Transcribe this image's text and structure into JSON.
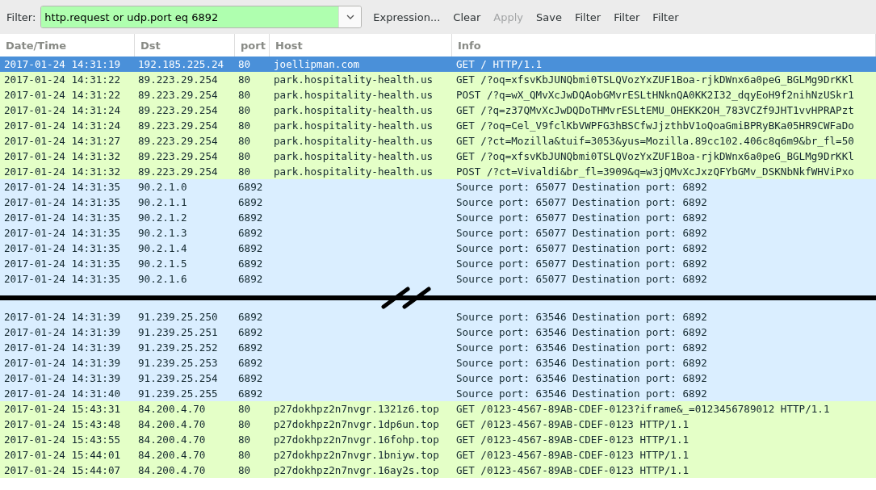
{
  "toolbar": {
    "label": "Filter:",
    "filter": {
      "value": "http.request or udp.port eq 6892",
      "valid": true
    },
    "buttons": [
      {
        "label": "Expression...",
        "disabled": false
      },
      {
        "label": "Clear",
        "disabled": false
      },
      {
        "label": "Apply",
        "disabled": true
      },
      {
        "label": "Save",
        "disabled": false
      },
      {
        "label": "Filter",
        "disabled": false
      },
      {
        "label": "Filter",
        "disabled": false
      },
      {
        "label": "Filter",
        "disabled": false
      }
    ]
  },
  "table": {
    "columns": [
      "Date/Time",
      "Dst",
      "port",
      "Host",
      "Info"
    ],
    "rows": [
      {
        "kind": "http",
        "selected": true,
        "cells": [
          "2017-01-24 14:31:19",
          "192.185.225.24",
          "80",
          "joellipman.com",
          "GET / HTTP/1.1"
        ]
      },
      {
        "kind": "http",
        "selected": false,
        "cells": [
          "2017-01-24 14:31:22",
          "89.223.29.254",
          "80",
          "park.hospitality-health.us",
          "GET /?oq=xfsvKbJUNQbmi0TSLQVozYxZUF1Boa-rjkDWnx6a0peG_BGLMg9DrKKl"
        ]
      },
      {
        "kind": "http",
        "selected": false,
        "cells": [
          "2017-01-24 14:31:22",
          "89.223.29.254",
          "80",
          "park.hospitality-health.us",
          "POST /?q=wX_QMvXcJwDQAobGMvrESLtHNknQA0KK2I32_dqyEoH9f2nihNzUSkr1"
        ]
      },
      {
        "kind": "http",
        "selected": false,
        "cells": [
          "2017-01-24 14:31:24",
          "89.223.29.254",
          "80",
          "park.hospitality-health.us",
          "GET /?q=z37QMvXcJwDQDoTHMvrESLtEMU_OHEKK2OH_783VCZf9JHT1vvHPRAPzt"
        ]
      },
      {
        "kind": "http",
        "selected": false,
        "cells": [
          "2017-01-24 14:31:24",
          "89.223.29.254",
          "80",
          "park.hospitality-health.us",
          "GET /?oq=Cel_V9fclKbVWPFG3hBSCfwJjzthbV1oQoaGmiBPRyBKa05HR9CWFaDo"
        ]
      },
      {
        "kind": "http",
        "selected": false,
        "cells": [
          "2017-01-24 14:31:27",
          "89.223.29.254",
          "80",
          "park.hospitality-health.us",
          "GET /?ct=Mozilla&tuif=3053&yus=Mozilla.89cc102.406c8q6m9&br_fl=50"
        ]
      },
      {
        "kind": "http",
        "selected": false,
        "cells": [
          "2017-01-24 14:31:32",
          "89.223.29.254",
          "80",
          "park.hospitality-health.us",
          "GET /?oq=xfsvKbJUNQbmi0TSLQVozYxZUF1Boa-rjkDWnx6a0peG_BGLMg9DrKKl"
        ]
      },
      {
        "kind": "http",
        "selected": false,
        "cells": [
          "2017-01-24 14:31:32",
          "89.223.29.254",
          "80",
          "park.hospitality-health.us",
          "POST /?ct=Vivaldi&br_fl=3909&q=w3jQMvXcJxzQFYbGMv_DSKNbNkfWHViPxo"
        ]
      },
      {
        "kind": "udp",
        "selected": false,
        "cells": [
          "2017-01-24 14:31:35",
          "90.2.1.0",
          "6892",
          "",
          "Source port: 65077  Destination port: 6892"
        ]
      },
      {
        "kind": "udp",
        "selected": false,
        "cells": [
          "2017-01-24 14:31:35",
          "90.2.1.1",
          "6892",
          "",
          "Source port: 65077  Destination port: 6892"
        ]
      },
      {
        "kind": "udp",
        "selected": false,
        "cells": [
          "2017-01-24 14:31:35",
          "90.2.1.2",
          "6892",
          "",
          "Source port: 65077  Destination port: 6892"
        ]
      },
      {
        "kind": "udp",
        "selected": false,
        "cells": [
          "2017-01-24 14:31:35",
          "90.2.1.3",
          "6892",
          "",
          "Source port: 65077  Destination port: 6892"
        ]
      },
      {
        "kind": "udp",
        "selected": false,
        "cells": [
          "2017-01-24 14:31:35",
          "90.2.1.4",
          "6892",
          "",
          "Source port: 65077  Destination port: 6892"
        ]
      },
      {
        "kind": "udp",
        "selected": false,
        "cells": [
          "2017-01-24 14:31:35",
          "90.2.1.5",
          "6892",
          "",
          "Source port: 65077  Destination port: 6892"
        ]
      },
      {
        "kind": "udp",
        "selected": false,
        "cells": [
          "2017-01-24 14:31:35",
          "90.2.1.6",
          "6892",
          "",
          "Source port: 65077  Destination port: 6892"
        ]
      },
      {
        "kind": "break"
      },
      {
        "kind": "udp",
        "selected": false,
        "cells": [
          "2017-01-24 14:31:39",
          "91.239.25.250",
          "6892",
          "",
          "Source port: 63546  Destination port: 6892"
        ]
      },
      {
        "kind": "udp",
        "selected": false,
        "cells": [
          "2017-01-24 14:31:39",
          "91.239.25.251",
          "6892",
          "",
          "Source port: 63546  Destination port: 6892"
        ]
      },
      {
        "kind": "udp",
        "selected": false,
        "cells": [
          "2017-01-24 14:31:39",
          "91.239.25.252",
          "6892",
          "",
          "Source port: 63546  Destination port: 6892"
        ]
      },
      {
        "kind": "udp",
        "selected": false,
        "cells": [
          "2017-01-24 14:31:39",
          "91.239.25.253",
          "6892",
          "",
          "Source port: 63546  Destination port: 6892"
        ]
      },
      {
        "kind": "udp",
        "selected": false,
        "cells": [
          "2017-01-24 14:31:39",
          "91.239.25.254",
          "6892",
          "",
          "Source port: 63546  Destination port: 6892"
        ]
      },
      {
        "kind": "udp",
        "selected": false,
        "cells": [
          "2017-01-24 14:31:40",
          "91.239.25.255",
          "6892",
          "",
          "Source port: 63546  Destination port: 6892"
        ]
      },
      {
        "kind": "http",
        "selected": false,
        "cells": [
          "2017-01-24 15:43:31",
          "84.200.4.70",
          "80",
          "p27dokhpz2n7nvgr.1321z6.top",
          "GET /0123-4567-89AB-CDEF-0123?iframe&_=0123456789012 HTTP/1.1"
        ]
      },
      {
        "kind": "http",
        "selected": false,
        "cells": [
          "2017-01-24 15:43:48",
          "84.200.4.70",
          "80",
          "p27dokhpz2n7nvgr.1dp6un.top",
          "GET /0123-4567-89AB-CDEF-0123 HTTP/1.1"
        ]
      },
      {
        "kind": "http",
        "selected": false,
        "cells": [
          "2017-01-24 15:43:55",
          "84.200.4.70",
          "80",
          "p27dokhpz2n7nvgr.16fohp.top",
          "GET /0123-4567-89AB-CDEF-0123 HTTP/1.1"
        ]
      },
      {
        "kind": "http",
        "selected": false,
        "cells": [
          "2017-01-24 15:44:01",
          "84.200.4.70",
          "80",
          "p27dokhpz2n7nvgr.1bniyw.top",
          "GET /0123-4567-89AB-CDEF-0123 HTTP/1.1"
        ]
      },
      {
        "kind": "http",
        "selected": false,
        "cells": [
          "2017-01-24 15:44:07",
          "84.200.4.70",
          "80",
          "p27dokhpz2n7nvgr.16ay2s.top",
          "GET /0123-4567-89AB-CDEF-0123 HTTP/1.1"
        ]
      }
    ]
  }
}
